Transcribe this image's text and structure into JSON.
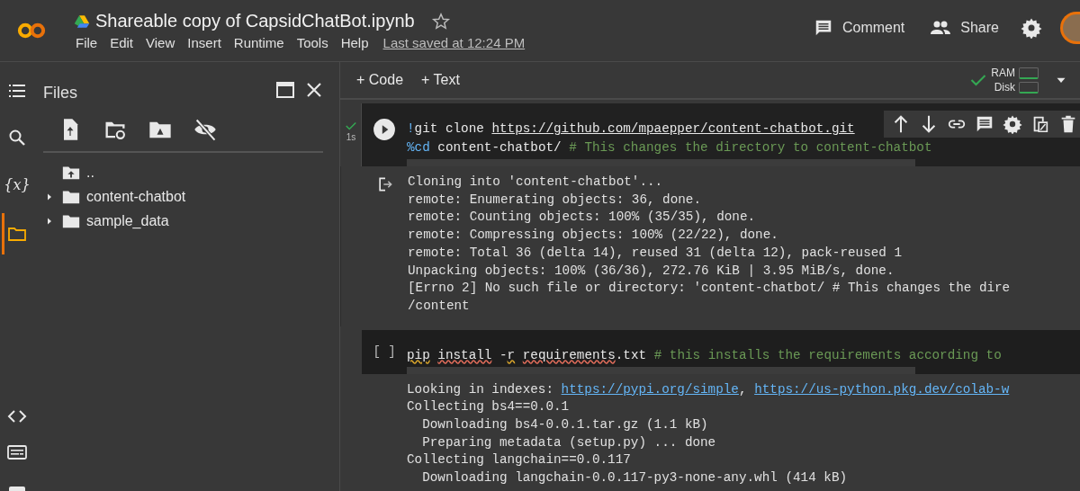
{
  "header": {
    "title": "Shareable copy of CapsidChatBot.ipynb",
    "starred": false,
    "menu": [
      "File",
      "Edit",
      "View",
      "Insert",
      "Runtime",
      "Tools",
      "Help"
    ],
    "last_saved": "Last saved at 12:24 PM",
    "comment_label": "Comment",
    "share_label": "Share"
  },
  "rail": {
    "top": [
      {
        "kind": "toc",
        "selected": false
      },
      {
        "kind": "search",
        "selected": false
      },
      {
        "kind": "variables",
        "glyph": "{x}",
        "selected": false
      },
      {
        "kind": "files",
        "selected": true
      }
    ],
    "bottom": [
      {
        "kind": "code",
        "selected": false
      },
      {
        "kind": "terminal",
        "selected": false
      },
      {
        "kind": "partial",
        "selected": false
      }
    ]
  },
  "files": {
    "title": "Files",
    "tree": [
      {
        "name": "..",
        "kind": "parent"
      },
      {
        "name": "content-chatbot",
        "kind": "folder",
        "expandable": true
      },
      {
        "name": "sample_data",
        "kind": "folder",
        "expandable": true
      }
    ]
  },
  "toolbar": {
    "code_label": "+ Code",
    "text_label": "+ Text",
    "connected": true,
    "ram_label": "RAM",
    "disk_label": "Disk"
  },
  "cells": [
    {
      "executed": true,
      "time": "1s",
      "code": [
        [
          {
            "kind": "magic",
            "text": "!"
          },
          {
            "kind": "plain",
            "text": "git clone "
          },
          {
            "kind": "link",
            "text": "https://github.com/mpaepper/content-chatbot.git"
          }
        ],
        [
          {
            "kind": "magic",
            "text": "%cd"
          },
          {
            "kind": "plain",
            "text": " content-chatbot/ "
          },
          {
            "kind": "comment",
            "text": "# This changes the directory to content-chatbot"
          }
        ]
      ],
      "output_icon": true,
      "output": [
        [
          {
            "kind": "plain",
            "text": "Cloning into 'content-chatbot'..."
          }
        ],
        [
          {
            "kind": "plain",
            "text": "remote: Enumerating objects: 36, done."
          }
        ],
        [
          {
            "kind": "plain",
            "text": "remote: Counting objects: 100% (35/35), done."
          }
        ],
        [
          {
            "kind": "plain",
            "text": "remote: Compressing objects: 100% (22/22), done."
          }
        ],
        [
          {
            "kind": "plain",
            "text": "remote: Total 36 (delta 14), reused 31 (delta 12), pack-reused 1"
          }
        ],
        [
          {
            "kind": "plain",
            "text": "Unpacking objects: 100% (36/36), 272.76 KiB | 3.95 MiB/s, done."
          }
        ],
        [
          {
            "kind": "plain",
            "text": "[Errno 2] No such file or directory: 'content-chatbot/ # This changes the dire"
          }
        ],
        [
          {
            "kind": "plain",
            "text": "/content"
          }
        ]
      ]
    },
    {
      "executed": false,
      "prompt": "[ ]",
      "code": [
        [
          {
            "kind": "spell_warning",
            "text": "pip "
          },
          {
            "kind": "spell_error",
            "text": "install"
          },
          {
            "kind": "plain",
            "text": " -"
          },
          {
            "kind": "spell_warning",
            "text": "r "
          },
          {
            "kind": "spell_error",
            "text": "requirements"
          },
          {
            "kind": "plain",
            "text": ".txt "
          },
          {
            "kind": "comment",
            "text": "# this installs the requirements according to"
          }
        ]
      ],
      "output": [
        [
          {
            "kind": "plain",
            "text": "Looking in indexes: "
          },
          {
            "kind": "link",
            "text": "https://pypi.org/simple"
          },
          {
            "kind": "plain",
            "text": ", "
          },
          {
            "kind": "link",
            "text": "https://us-python.pkg.dev/colab-w"
          }
        ],
        [
          {
            "kind": "plain",
            "text": "Collecting bs4==0.0.1"
          }
        ],
        [
          {
            "kind": "plain",
            "text": "  Downloading bs4-0.0.1.tar.gz (1.1 kB)"
          }
        ],
        [
          {
            "kind": "plain",
            "text": "  Preparing metadata (setup.py) ... done"
          }
        ],
        [
          {
            "kind": "plain",
            "text": "Collecting langchain==0.0.117"
          }
        ],
        [
          {
            "kind": "plain",
            "text": "  Downloading langchain-0.0.117-py3-none-any.whl (414 kB)"
          }
        ]
      ]
    }
  ]
}
